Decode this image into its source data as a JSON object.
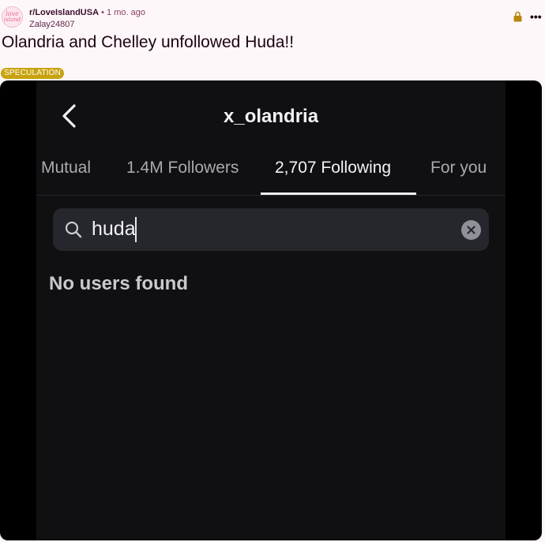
{
  "post": {
    "subreddit": "r/LoveIslandUSA",
    "separator": "•",
    "age": "1 mo. ago",
    "author": "Zalay24807",
    "title": "Olandria and Chelley unfollowed Huda!!",
    "flair": "SPECULATION",
    "avatar": {
      "line1": "love",
      "line2": "island"
    },
    "more_menu": "•••",
    "colors": {
      "flair_bg": "#c9a20f",
      "lock": "#b8860b",
      "page_bg": "#fdf7fa"
    }
  },
  "media": {
    "profile_name": "x_olandria",
    "tabs": [
      {
        "label": "Mutual"
      },
      {
        "label": "1.4M Followers"
      },
      {
        "label": "2,707 Following",
        "active": true
      },
      {
        "label": "For you"
      }
    ],
    "search": {
      "value": "huda"
    },
    "empty_message": "No users found",
    "icons": {
      "back": "chevron-left-icon",
      "search": "magnifier-icon",
      "clear": "clear-x-icon"
    }
  }
}
